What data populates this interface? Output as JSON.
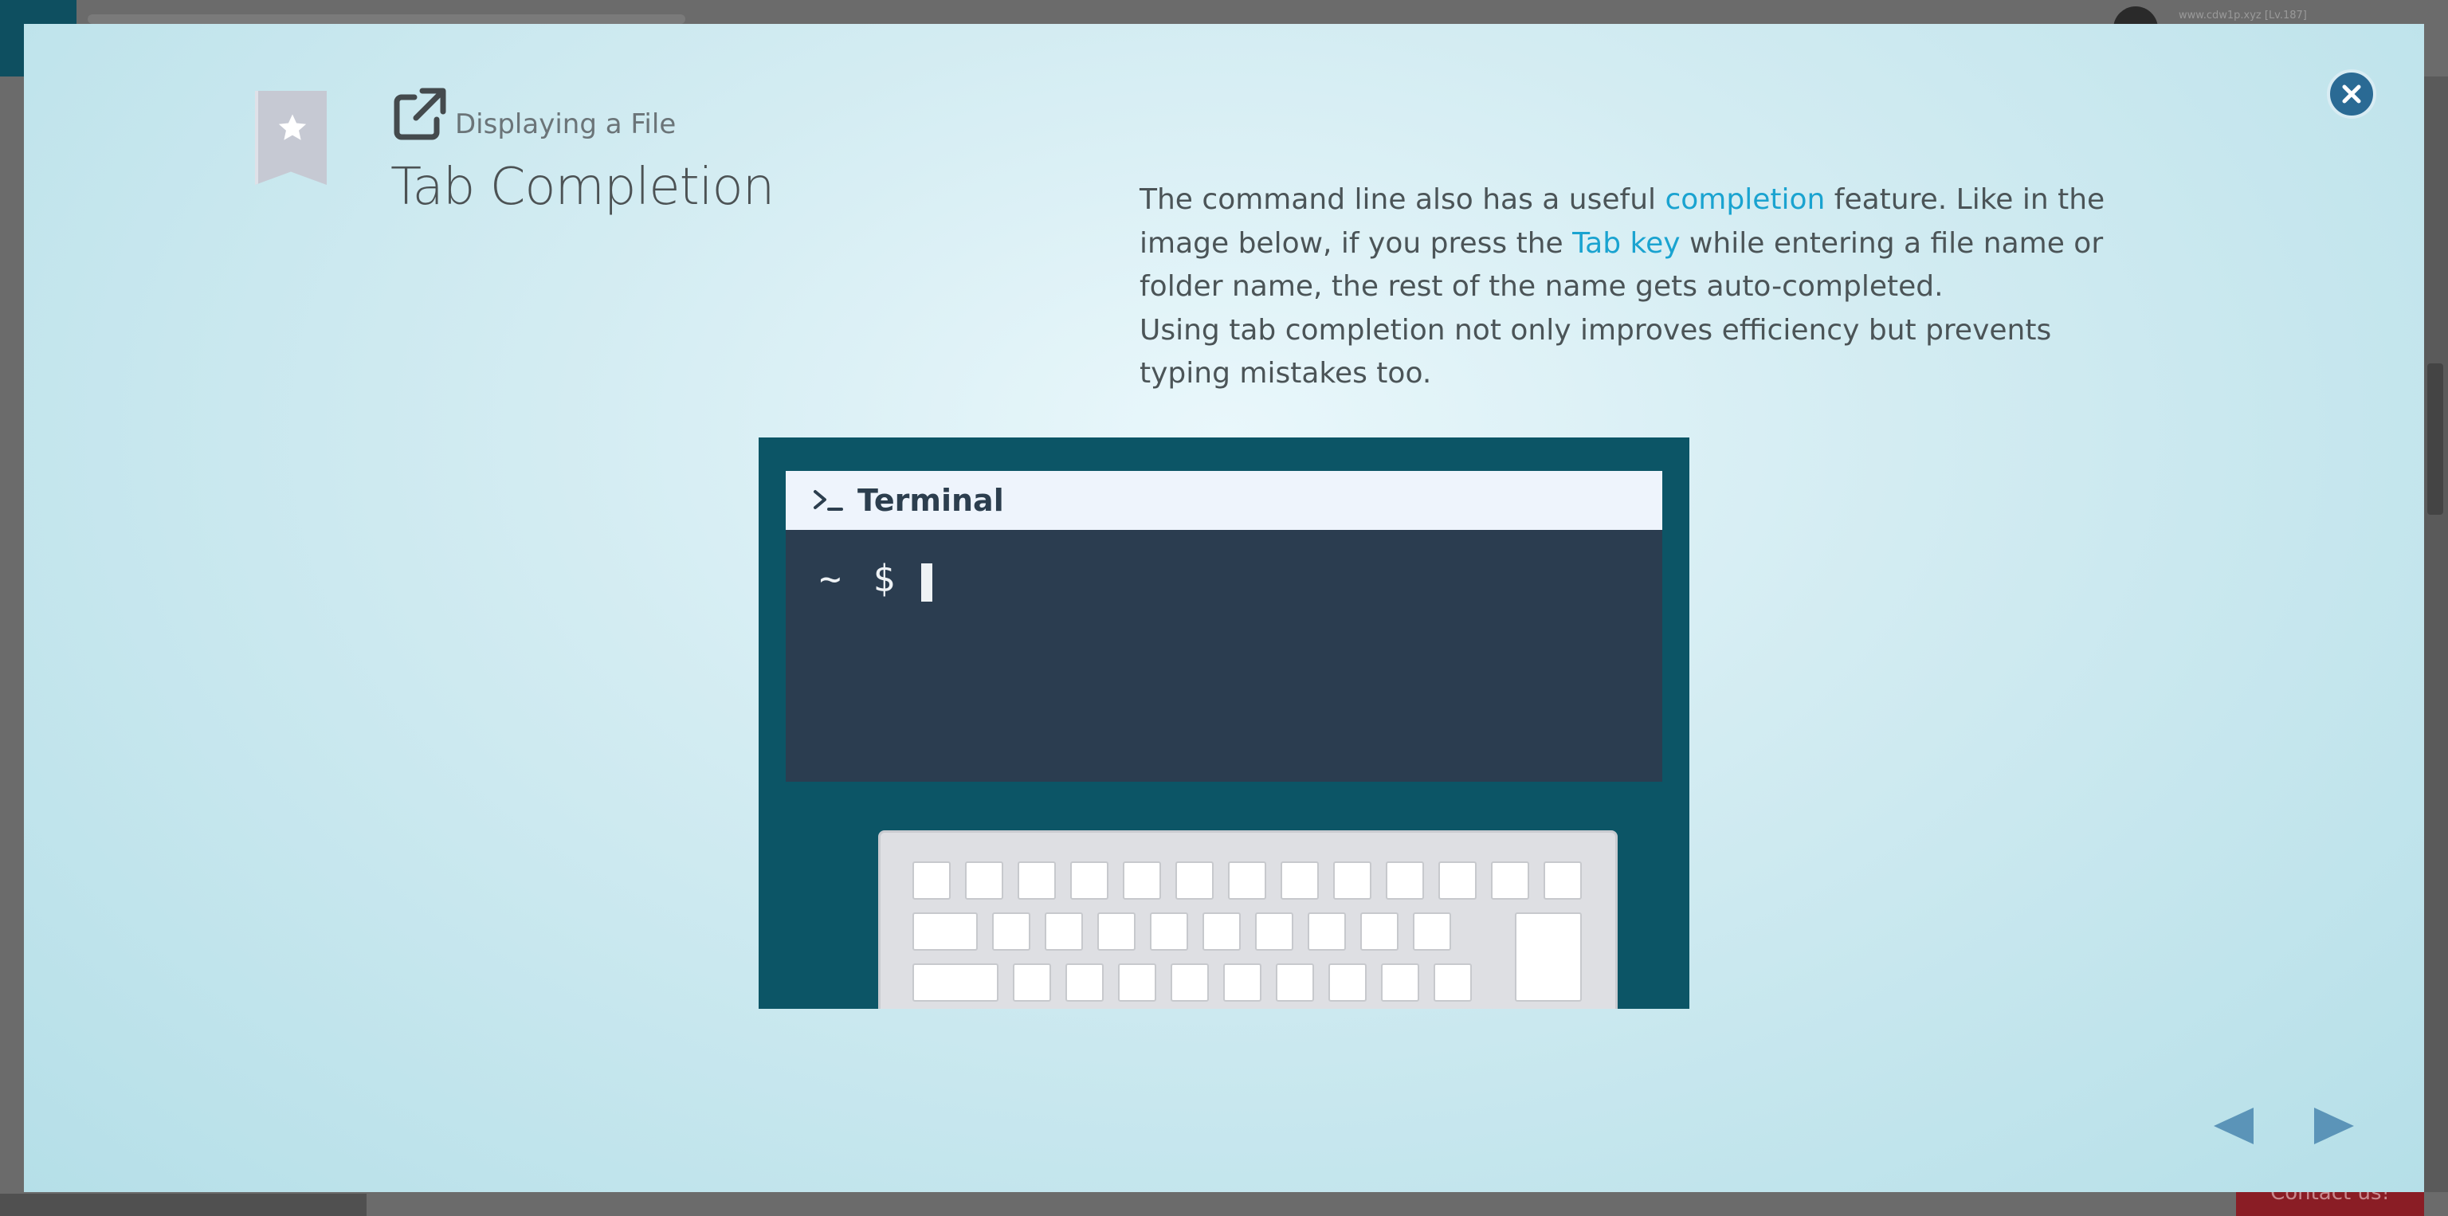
{
  "background": {
    "user_text": "www.cdw1p.xyz [Lv.187]",
    "contact_label": "Contact us!"
  },
  "lesson": {
    "category": "Displaying a File",
    "title": "Tab Completion",
    "body": {
      "p1_part1": "The command line also has a useful ",
      "p1_link1": "completion",
      "p1_part2": " feature. Like in the image below, if you press the ",
      "p1_link2": "Tab key",
      "p1_part3": " while entering a file name or folder name, the rest of the name gets auto-completed.",
      "p2": "Using tab completion not only improves efficiency but prevents typing mistakes too."
    }
  },
  "illustration": {
    "terminal_title": "Terminal",
    "prompt": "~ $"
  },
  "colors": {
    "accent_link": "#1aa3d0",
    "close_button": "#2a6a94",
    "nav_arrow": "#5b94b8",
    "illustration_bg": "#0c5566",
    "terminal_bg": "#2b3d50"
  },
  "icons": {
    "bookmark": "star-bookmark-icon",
    "category": "external-link-icon",
    "close": "close-icon",
    "prev": "triangle-left-icon",
    "next": "triangle-right-icon",
    "terminal": "terminal-prompt-icon"
  }
}
